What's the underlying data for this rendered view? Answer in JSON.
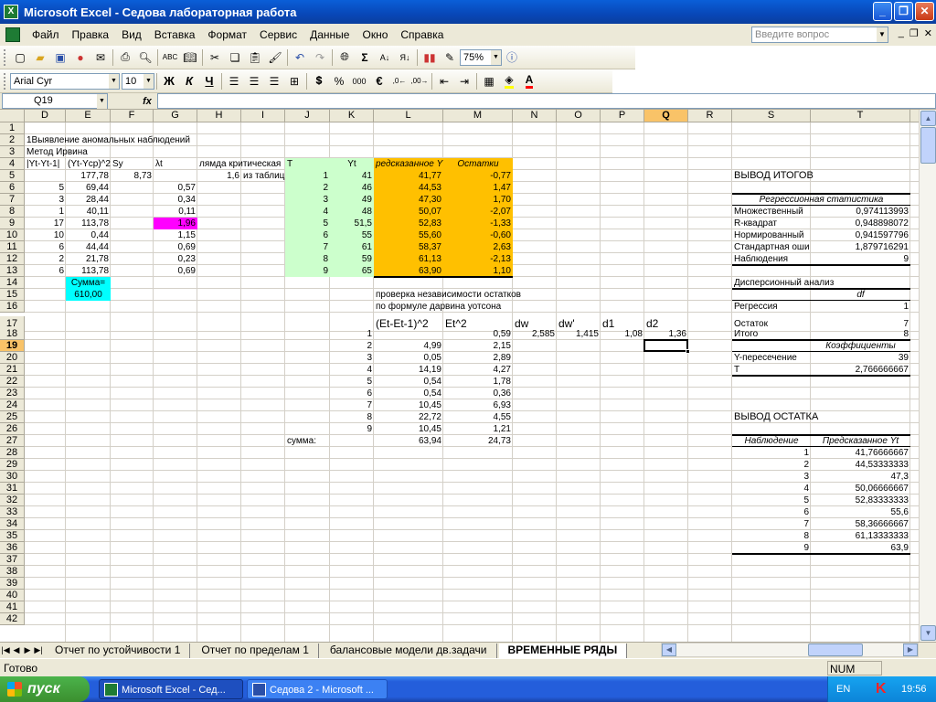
{
  "window": {
    "title": "Microsoft Excel - Седова лабораторная работа"
  },
  "menu": {
    "items": [
      "Файл",
      "Правка",
      "Вид",
      "Вставка",
      "Формат",
      "Сервис",
      "Данные",
      "Окно",
      "Справка"
    ],
    "question_placeholder": "Введите вопрос"
  },
  "toolbar": {
    "zoom": "75%",
    "font": "Arial Cyr",
    "size": "10",
    "bold": "Ж",
    "italic": "К",
    "underline": "Ч",
    "percent": "%",
    "thousands": "000",
    "euro": "€"
  },
  "formula_bar": {
    "name_box": "Q19",
    "fx": "fx",
    "content": ""
  },
  "columns": [
    "D",
    "E",
    "F",
    "G",
    "H",
    "I",
    "J",
    "K",
    "L",
    "M",
    "N",
    "O",
    "P",
    "Q",
    "R",
    "S",
    "T"
  ],
  "rows": [
    "1",
    "2",
    "3",
    "4",
    "5",
    "6",
    "7",
    "8",
    "9",
    "10",
    "11",
    "12",
    "13",
    "14",
    "15",
    "16",
    "17",
    "18",
    "19",
    "20",
    "21",
    "22",
    "23",
    "24",
    "25",
    "26",
    "27",
    "28",
    "29",
    "30",
    "31",
    "32",
    "33",
    "34",
    "35",
    "36",
    "37",
    "38",
    "39",
    "40",
    "41",
    "42"
  ],
  "sheet": {
    "title1": "1Выявление аномальных наблюдений",
    "title2": "Метод Ирвина",
    "hdr_d": "|Yt-Yt-1|",
    "hdr_e": "(Yt-Ycp)^2",
    "hdr_f": "Sy",
    "hdr_g": "λt",
    "hdr_h": "лямда критическая",
    "hdr_j": "T",
    "hdr_k": "Yt",
    "hdr_l": "редсказанное Y",
    "hdr_m": "Остатки",
    "sy": "8,73",
    "lambda_crit": "1,6",
    "from_table": "из таблицы",
    "d_vals": [
      "",
      "5",
      "3",
      "1",
      "17",
      "10",
      "6",
      "2",
      "6"
    ],
    "e_vals": [
      "177,78",
      "69,44",
      "28,44",
      "40,11",
      "113,78",
      "0,44",
      "44,44",
      "21,78",
      "113,78"
    ],
    "g_vals": [
      "",
      "0,57",
      "0,34",
      "0,11",
      "1,96",
      "1,15",
      "0,69",
      "0,23",
      "0,69"
    ],
    "j_vals": [
      "1",
      "2",
      "3",
      "4",
      "5",
      "6",
      "7",
      "8",
      "9"
    ],
    "k_vals": [
      "41",
      "46",
      "49",
      "48",
      "51,5",
      "55",
      "61",
      "59",
      "65"
    ],
    "l_vals": [
      "41,77",
      "44,53",
      "47,30",
      "50,07",
      "52,83",
      "55,60",
      "58,37",
      "61,13",
      "63,90"
    ],
    "m_vals": [
      "-0,77",
      "1,47",
      "1,70",
      "-2,07",
      "-1,33",
      "-0,60",
      "2,63",
      "-2,13",
      "1,10"
    ],
    "sum_label": "Сумма=",
    "sum_val": "610,00",
    "check1": "проверка независимости остатков",
    "check2": "по формуле дарвина уотсона",
    "h_l17": "(Et-Et-1)^2",
    "h_m17": "Et^2",
    "h_n17": "dw",
    "h_o17": "dw'",
    "h_p17": "d1",
    "h_q17": "d2",
    "k_idx": [
      "1",
      "2",
      "3",
      "4",
      "5",
      "6",
      "7",
      "8",
      "9"
    ],
    "l_sq": [
      "",
      "4,99",
      "0,05",
      "14,19",
      "0,54",
      "0,54",
      "10,45",
      "22,72",
      "10,45"
    ],
    "m_sq": [
      "0,59",
      "2,15",
      "2,89",
      "4,27",
      "1,78",
      "0,36",
      "6,93",
      "4,55",
      "1,21"
    ],
    "dw": "2,585",
    "dw2": "1,415",
    "d1": "1,08",
    "d2": "1,36",
    "sum_row_label": "сумма:",
    "sum_l": "63,94",
    "sum_m": "24,73",
    "summary_title": "ВЫВОД ИТОГОВ",
    "reg_stats": "Регрессионная статистика",
    "stats_labels": [
      "Множественный",
      "R-квадрат",
      "Нормированный",
      "Стандартная оши",
      "Наблюдения"
    ],
    "stats_vals": [
      "0,974113993",
      "0,948898072",
      "0,941597796",
      "1,879716291",
      "9"
    ],
    "anova_title": "Дисперсионный анализ",
    "df": "df",
    "anova_labels": [
      "Регрессия",
      "Остаток",
      "Итого"
    ],
    "anova_vals": [
      "1",
      "7",
      "8"
    ],
    "coef": "Коэффициенты",
    "coef_labels": [
      "Y-пересечение",
      "T"
    ],
    "coef_vals": [
      "39",
      "2,766666667"
    ],
    "resid_title": "ВЫВОД ОСТАТКА",
    "obs": "Наблюдение",
    "pred": "Предсказанное Yt",
    "obs_n": [
      "1",
      "2",
      "3",
      "4",
      "5",
      "6",
      "7",
      "8",
      "9"
    ],
    "pred_vals": [
      "41,76666667",
      "44,53333333",
      "47,3",
      "50,06666667",
      "52,83333333",
      "55,6",
      "58,36666667",
      "61,13333333",
      "63,9"
    ]
  },
  "tabs": [
    "Отчет по устойчивости 1",
    "Отчет по пределам 1",
    "балансовые модели дв.задачи",
    "ВРЕМЕННЫЕ РЯДЫ"
  ],
  "status": {
    "ready": "Готово",
    "num": "NUM"
  },
  "taskbar": {
    "start": "пуск",
    "task1": "Microsoft Excel - Сед...",
    "task2": "Седова 2 - Microsoft ...",
    "lang": "EN",
    "clock": "19:56"
  }
}
